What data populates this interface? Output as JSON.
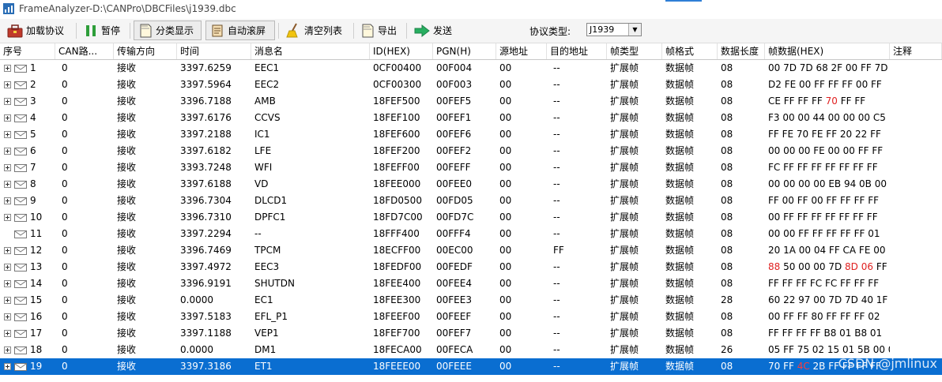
{
  "window": {
    "title": "FrameAnalyzer-D:\\CANPro\\DBCFiles\\j1939.dbc"
  },
  "toolbar": {
    "load_protocol": "加载协议",
    "pause": "暂停",
    "classify_display": "分类显示",
    "auto_scroll": "自动滚屏",
    "clear_list": "清空列表",
    "export": "导出",
    "send": "发送",
    "protocol_type_label": "协议类型:",
    "protocol_type_value": "J1939"
  },
  "table": {
    "columns": [
      "序号",
      "CAN路...",
      "传输方向",
      "时间",
      "消息名",
      "ID(HEX)",
      "PGN(H)",
      "源地址",
      "目的地址",
      "帧类型",
      "帧格式",
      "数据长度",
      "帧数据(HEX)",
      "注释"
    ],
    "rows": [
      {
        "seq": "1",
        "can": "0",
        "dir": "接收",
        "time": "3397.6259",
        "name": "EEC1",
        "id": "0CF00400",
        "pgn": "00F004",
        "src": "00",
        "dst": "--",
        "ftype": "扩展帧",
        "ffmt": "数据帧",
        "len": "08",
        "data": [
          {
            "t": "00 7D 7D 68 2F 00 FF 7D"
          }
        ],
        "note": "",
        "expandable": true
      },
      {
        "seq": "2",
        "can": "0",
        "dir": "接收",
        "time": "3397.5964",
        "name": "EEC2",
        "id": "0CF00300",
        "pgn": "00F003",
        "src": "00",
        "dst": "--",
        "ftype": "扩展帧",
        "ffmt": "数据帧",
        "len": "08",
        "data": [
          {
            "t": "D2 FE 00 FF FF FF 00 FF"
          }
        ],
        "note": "",
        "expandable": true
      },
      {
        "seq": "3",
        "can": "0",
        "dir": "接收",
        "time": "3396.7188",
        "name": "AMB",
        "id": "18FEF500",
        "pgn": "00FEF5",
        "src": "00",
        "dst": "--",
        "ftype": "扩展帧",
        "ffmt": "数据帧",
        "len": "08",
        "data": [
          {
            "t": "CE FF FF FF "
          },
          {
            "t": "70",
            "red": true
          },
          {
            "t": " FF FF"
          }
        ],
        "note": "",
        "expandable": true
      },
      {
        "seq": "4",
        "can": "0",
        "dir": "接收",
        "time": "3397.6176",
        "name": "CCVS",
        "id": "18FEF100",
        "pgn": "00FEF1",
        "src": "00",
        "dst": "--",
        "ftype": "扩展帧",
        "ffmt": "数据帧",
        "len": "08",
        "data": [
          {
            "t": "F3 00 00 44 00 00 00 C5"
          }
        ],
        "note": "",
        "expandable": true
      },
      {
        "seq": "5",
        "can": "0",
        "dir": "接收",
        "time": "3397.2188",
        "name": "IC1",
        "id": "18FEF600",
        "pgn": "00FEF6",
        "src": "00",
        "dst": "--",
        "ftype": "扩展帧",
        "ffmt": "数据帧",
        "len": "08",
        "data": [
          {
            "t": "FF FE 70 FE FF 20 22 FF"
          }
        ],
        "note": "",
        "expandable": true
      },
      {
        "seq": "6",
        "can": "0",
        "dir": "接收",
        "time": "3397.6182",
        "name": "LFE",
        "id": "18FEF200",
        "pgn": "00FEF2",
        "src": "00",
        "dst": "--",
        "ftype": "扩展帧",
        "ffmt": "数据帧",
        "len": "08",
        "data": [
          {
            "t": "00 00 00 FE 00 00 FF FF"
          }
        ],
        "note": "",
        "expandable": true
      },
      {
        "seq": "7",
        "can": "0",
        "dir": "接收",
        "time": "3393.7248",
        "name": "WFI",
        "id": "18FEFF00",
        "pgn": "00FEFF",
        "src": "00",
        "dst": "--",
        "ftype": "扩展帧",
        "ffmt": "数据帧",
        "len": "08",
        "data": [
          {
            "t": "FC FF FF FF FF FF FF FF"
          }
        ],
        "note": "",
        "expandable": true
      },
      {
        "seq": "8",
        "can": "0",
        "dir": "接收",
        "time": "3397.6188",
        "name": "VD",
        "id": "18FEE000",
        "pgn": "00FEE0",
        "src": "00",
        "dst": "--",
        "ftype": "扩展帧",
        "ffmt": "数据帧",
        "len": "08",
        "data": [
          {
            "t": "00 00 00 00 EB 94 0B 00"
          }
        ],
        "note": "",
        "expandable": true
      },
      {
        "seq": "9",
        "can": "0",
        "dir": "接收",
        "time": "3396.7304",
        "name": "DLCD1",
        "id": "18FD0500",
        "pgn": "00FD05",
        "src": "00",
        "dst": "--",
        "ftype": "扩展帧",
        "ffmt": "数据帧",
        "len": "08",
        "data": [
          {
            "t": "FF 00 FF 00 FF FF FF FF"
          }
        ],
        "note": "",
        "expandable": true
      },
      {
        "seq": "10",
        "can": "0",
        "dir": "接收",
        "time": "3396.7310",
        "name": "DPFC1",
        "id": "18FD7C00",
        "pgn": "00FD7C",
        "src": "00",
        "dst": "--",
        "ftype": "扩展帧",
        "ffmt": "数据帧",
        "len": "08",
        "data": [
          {
            "t": "00 FF FF FF FF FF FF FF"
          }
        ],
        "note": "",
        "expandable": true
      },
      {
        "seq": "11",
        "can": "0",
        "dir": "接收",
        "time": "3397.2294",
        "name": "--",
        "id": "18FFF400",
        "pgn": "00FFF4",
        "src": "00",
        "dst": "--",
        "ftype": "扩展帧",
        "ffmt": "数据帧",
        "len": "08",
        "data": [
          {
            "t": "00 00 FF FF FF FF FF 01"
          }
        ],
        "note": "",
        "expandable": false
      },
      {
        "seq": "12",
        "can": "0",
        "dir": "接收",
        "time": "3396.7469",
        "name": "TPCM",
        "id": "18ECFF00",
        "pgn": "00EC00",
        "src": "00",
        "dst": "FF",
        "ftype": "扩展帧",
        "ffmt": "数据帧",
        "len": "08",
        "data": [
          {
            "t": "20 1A 00 04 FF CA FE 00"
          }
        ],
        "note": "",
        "expandable": true
      },
      {
        "seq": "13",
        "can": "0",
        "dir": "接收",
        "time": "3397.4972",
        "name": "EEC3",
        "id": "18FEDF00",
        "pgn": "00FEDF",
        "src": "00",
        "dst": "--",
        "ftype": "扩展帧",
        "ffmt": "数据帧",
        "len": "08",
        "data": [
          {
            "t": "88",
            "red": true
          },
          {
            "t": " 50 00 00 7D "
          },
          {
            "t": "8D",
            "red": true
          },
          {
            "t": " "
          },
          {
            "t": "06",
            "red": true
          },
          {
            "t": " FF"
          }
        ],
        "note": "",
        "expandable": true
      },
      {
        "seq": "14",
        "can": "0",
        "dir": "接收",
        "time": "3396.9191",
        "name": "SHUTDN",
        "id": "18FEE400",
        "pgn": "00FEE4",
        "src": "00",
        "dst": "--",
        "ftype": "扩展帧",
        "ffmt": "数据帧",
        "len": "08",
        "data": [
          {
            "t": "FF FF FF FC FC FF FF FF"
          }
        ],
        "note": "",
        "expandable": true
      },
      {
        "seq": "15",
        "can": "0",
        "dir": "接收",
        "time": "0.0000",
        "name": "EC1",
        "id": "18FEE300",
        "pgn": "00FEE3",
        "src": "00",
        "dst": "--",
        "ftype": "扩展帧",
        "ffmt": "数据帧",
        "len": "28",
        "data": [
          {
            "t": "60 22 97 00 7D 7D 40 1F"
          }
        ],
        "note": "",
        "expandable": true
      },
      {
        "seq": "16",
        "can": "0",
        "dir": "接收",
        "time": "3397.5183",
        "name": "EFL_P1",
        "id": "18FEEF00",
        "pgn": "00FEEF",
        "src": "00",
        "dst": "--",
        "ftype": "扩展帧",
        "ffmt": "数据帧",
        "len": "08",
        "data": [
          {
            "t": "00 FF FF 80 FF FF FF 02"
          }
        ],
        "note": "",
        "expandable": true
      },
      {
        "seq": "17",
        "can": "0",
        "dir": "接收",
        "time": "3397.1188",
        "name": "VEP1",
        "id": "18FEF700",
        "pgn": "00FEF7",
        "src": "00",
        "dst": "--",
        "ftype": "扩展帧",
        "ffmt": "数据帧",
        "len": "08",
        "data": [
          {
            "t": "FF FF FF FF B8 01 B8 01"
          }
        ],
        "note": "",
        "expandable": true
      },
      {
        "seq": "18",
        "can": "0",
        "dir": "接收",
        "time": "0.0000",
        "name": "DM1",
        "id": "18FECA00",
        "pgn": "00FECA",
        "src": "00",
        "dst": "--",
        "ftype": "扩展帧",
        "ffmt": "数据帧",
        "len": "26",
        "data": [
          {
            "t": "05 FF 75 02 15 01 5B 00 0"
          }
        ],
        "note": "",
        "expandable": true
      },
      {
        "seq": "19",
        "can": "0",
        "dir": "接收",
        "time": "3397.3186",
        "name": "ET1",
        "id": "18FEEE00",
        "pgn": "00FEEE",
        "src": "00",
        "dst": "--",
        "ftype": "扩展帧",
        "ffmt": "数据帧",
        "len": "08",
        "data": [
          {
            "t": "70 FF "
          },
          {
            "t": "4C",
            "red": true
          },
          {
            "t": " 2B FF FF FF FF"
          }
        ],
        "note": "",
        "expandable": true,
        "selected": true
      }
    ]
  },
  "watermark": "CSDN @jmlinux",
  "colors": {
    "selection": "#0a6ed1",
    "highlight_byte": "#e02020"
  }
}
